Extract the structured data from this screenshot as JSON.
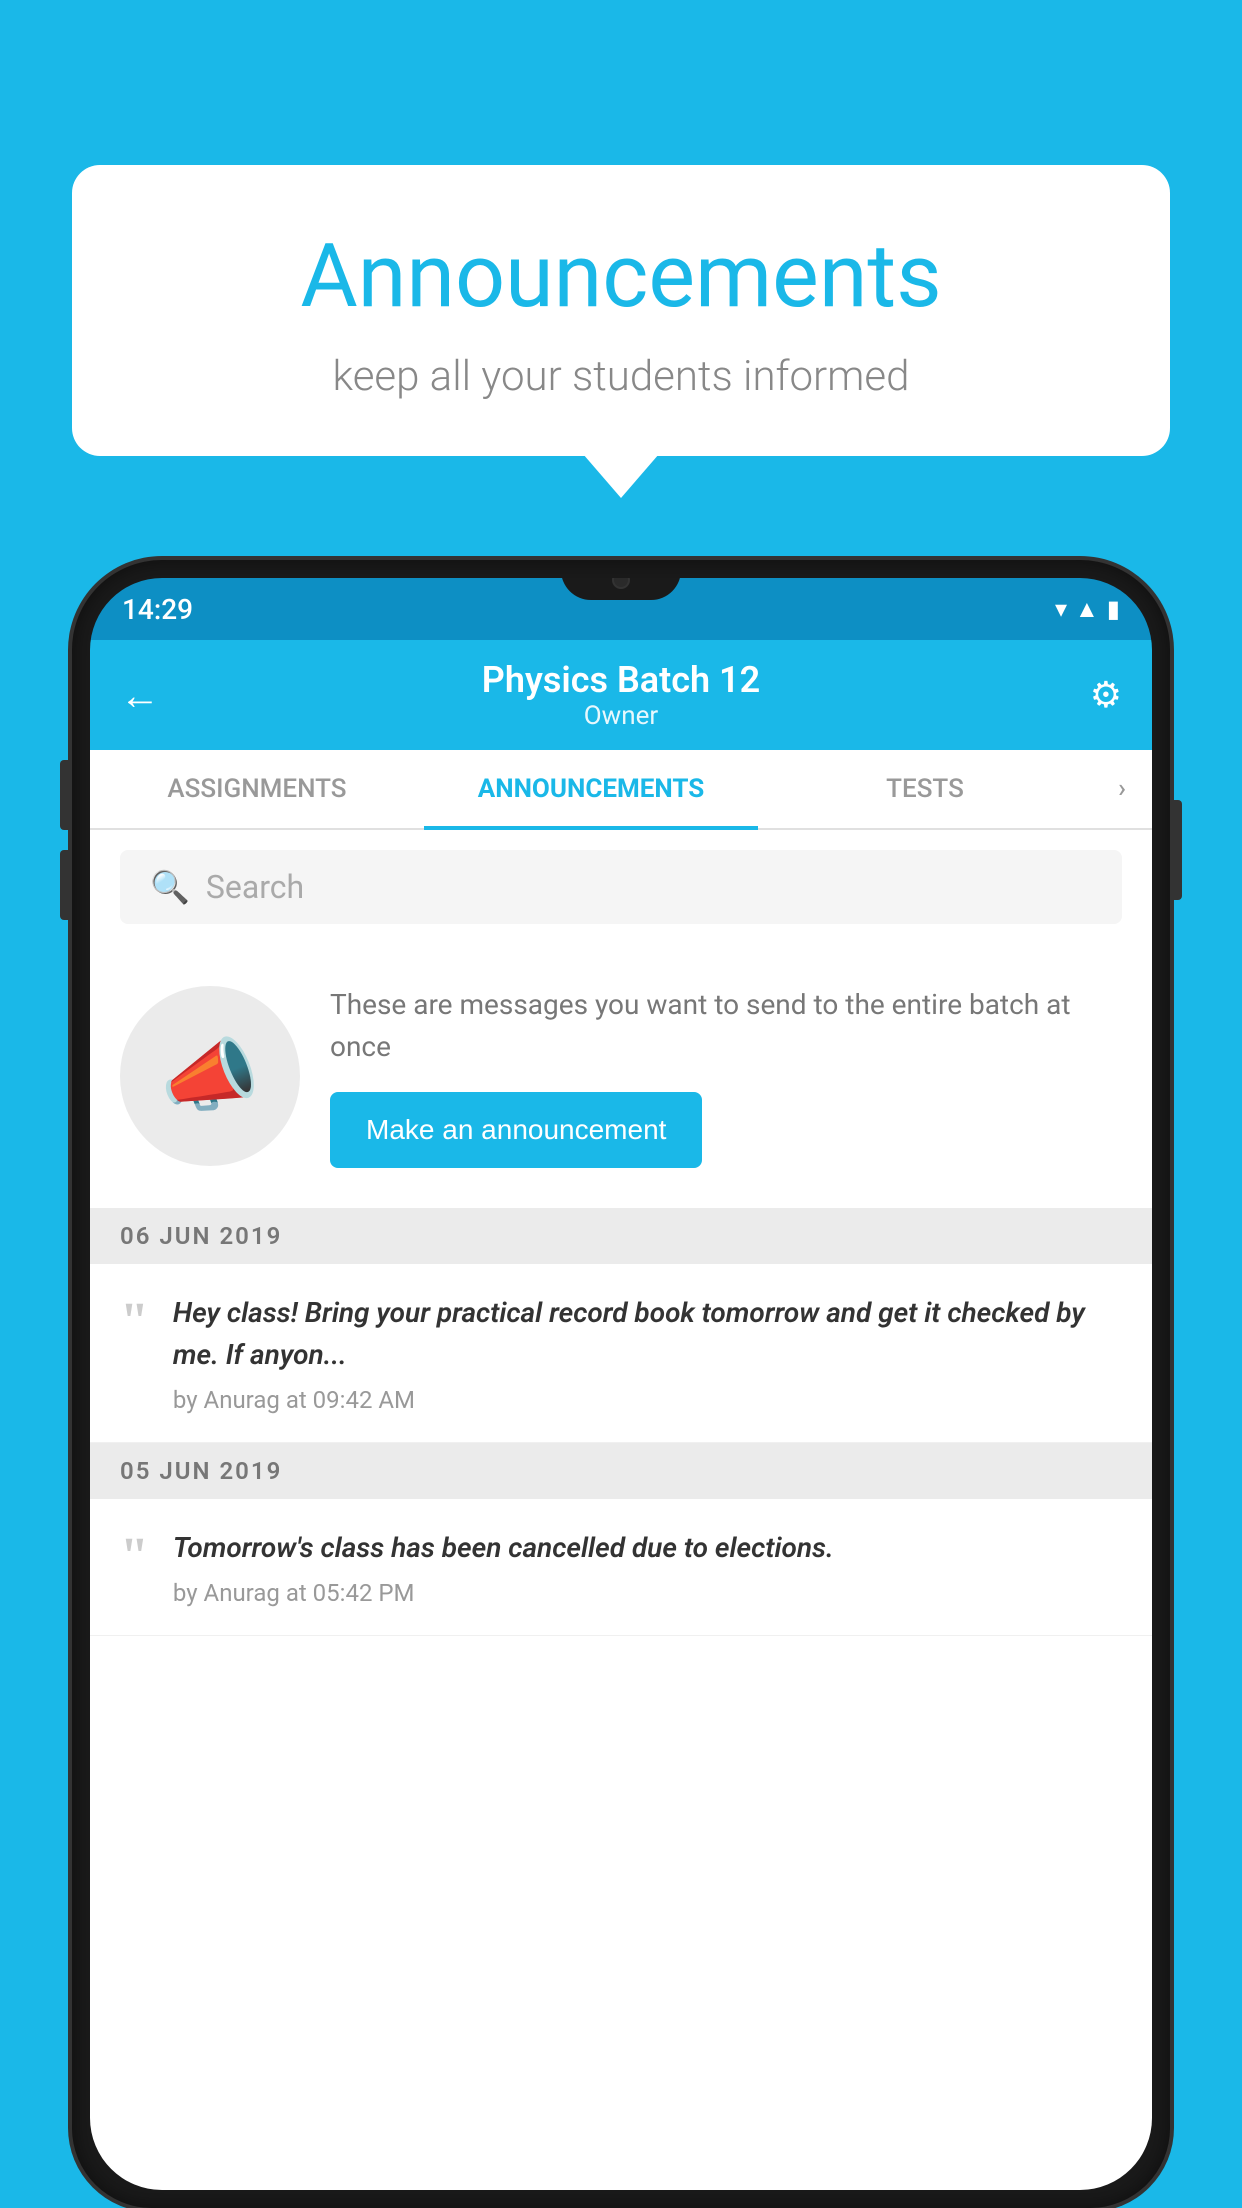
{
  "background_color": "#1ab8e8",
  "speech_bubble": {
    "title": "Announcements",
    "subtitle": "keep all your students informed"
  },
  "phone": {
    "status_bar": {
      "time": "14:29",
      "wifi": "▾",
      "signal": "▲",
      "battery": "▮"
    },
    "header": {
      "title": "Physics Batch 12",
      "subtitle": "Owner",
      "back_label": "←",
      "settings_label": "⚙"
    },
    "tabs": [
      {
        "label": "ASSIGNMENTS",
        "active": false
      },
      {
        "label": "ANNOUNCEMENTS",
        "active": true
      },
      {
        "label": "TESTS",
        "active": false
      },
      {
        "label": "›",
        "active": false
      }
    ],
    "search": {
      "placeholder": "Search"
    },
    "empty_state": {
      "description": "These are messages you want to send to the entire batch at once",
      "button_label": "Make an announcement"
    },
    "date_sections": [
      {
        "date": "06  JUN  2019",
        "items": [
          {
            "message": "Hey class! Bring your practical record book tomorrow and get it checked by me. If anyon...",
            "meta": "by Anurag at 09:42 AM"
          }
        ]
      },
      {
        "date": "05  JUN  2019",
        "items": [
          {
            "message": "Tomorrow's class has been cancelled due to elections.",
            "meta": "by Anurag at 05:42 PM"
          }
        ]
      }
    ]
  }
}
